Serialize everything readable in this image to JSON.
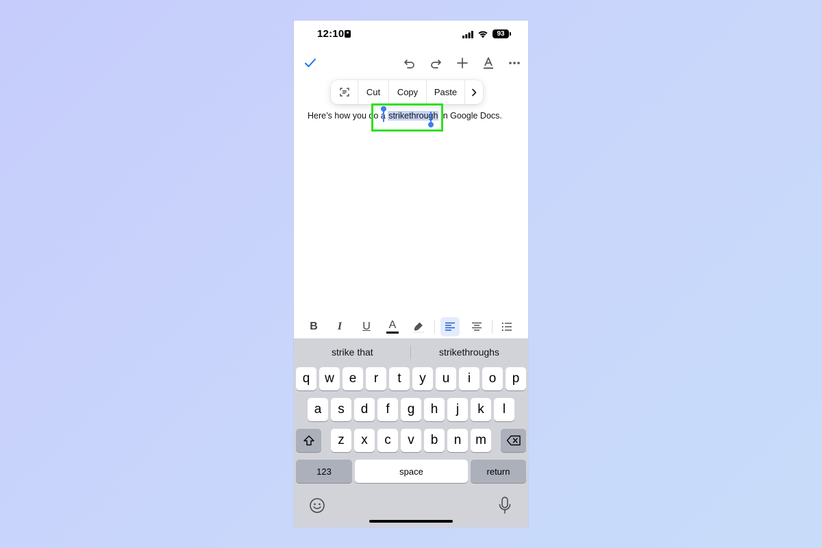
{
  "status_bar": {
    "time": "12:10",
    "battery": "93"
  },
  "toolbar": {
    "icons": [
      "check-icon",
      "undo-icon",
      "redo-icon",
      "plus-icon",
      "text-format-icon",
      "more-icon"
    ]
  },
  "context_menu": {
    "items": [
      "Cut",
      "Copy",
      "Paste"
    ]
  },
  "document": {
    "text_before": "Here’s how you do a ",
    "selected_text": "strikethrough",
    "text_after": " in Google Docs."
  },
  "format_bar": {
    "bold": "B",
    "italic": "I",
    "underline": "U",
    "text_color": "A"
  },
  "keyboard": {
    "suggestions": [
      "strike that",
      "strikethroughs"
    ],
    "row1": [
      "q",
      "w",
      "e",
      "r",
      "t",
      "y",
      "u",
      "i",
      "o",
      "p"
    ],
    "row2": [
      "a",
      "s",
      "d",
      "f",
      "g",
      "h",
      "j",
      "k",
      "l"
    ],
    "row3": [
      "z",
      "x",
      "c",
      "v",
      "b",
      "n",
      "m"
    ],
    "numbers_label": "123",
    "space_label": "space",
    "return_label": "return"
  },
  "colors": {
    "accent": "#3f7cf0",
    "highlight_box": "#2de11c",
    "selection": "#c5d3f5",
    "check": "#1a73e8"
  }
}
